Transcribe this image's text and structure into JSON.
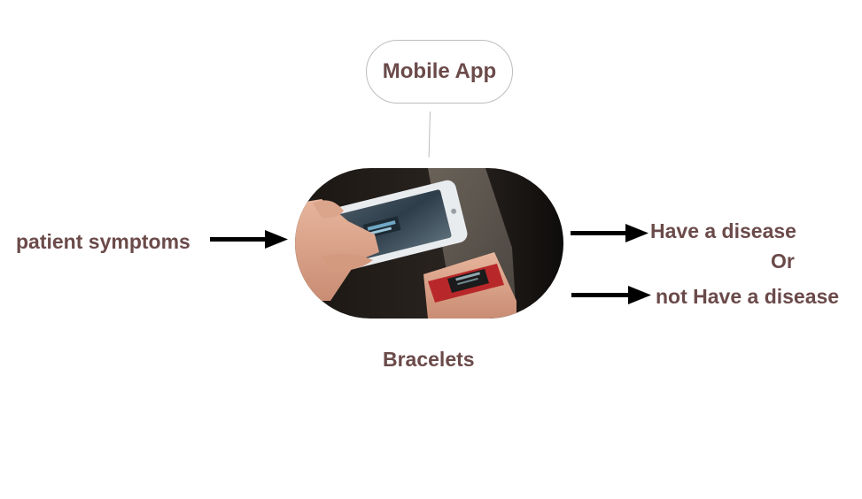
{
  "nodes": {
    "mobile_app": "Mobile App",
    "bracelets": "Bracelets",
    "input": "patient symptoms",
    "outcome_positive": "Have a disease",
    "separator": "Or",
    "outcome_negative": "not Have a disease"
  },
  "colors": {
    "text": "#6b4a4a",
    "border": "#bdbdbd",
    "arrow": "#000000"
  },
  "icons": {
    "device_image": "phone-and-bracelet-photo",
    "arrow": "right-arrow-icon"
  }
}
